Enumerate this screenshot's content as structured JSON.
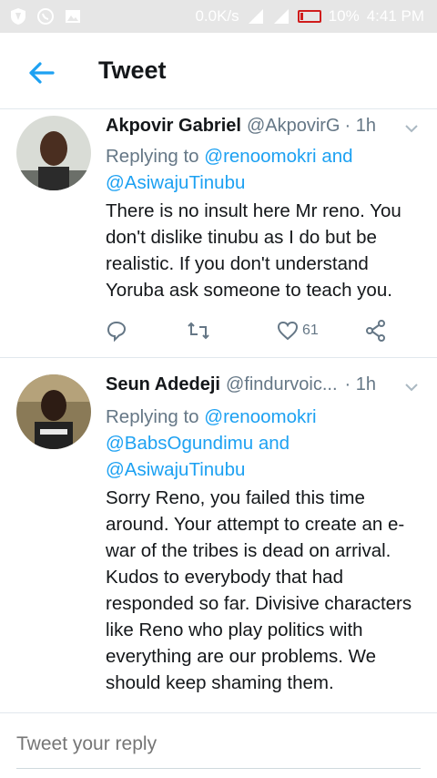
{
  "status_bar": {
    "speed": "0.0K/s",
    "battery": "10%",
    "time": "4:41 PM"
  },
  "header": {
    "title": "Tweet"
  },
  "tweets": [
    {
      "name": "Akpovir Gabriel",
      "handle": "@AkpovirG",
      "time": "· 1h",
      "replying_prefix": "Replying to ",
      "mentions_line1": "@renoomokri",
      "and1": " and",
      "mentions_line2": "@AsiwajuTinubu",
      "body": "There is no insult here Mr reno. You don't dislike tinubu as I do but be realistic. If you don't understand Yoruba ask someone to teach you.",
      "likes": "61"
    },
    {
      "name": "Seun Adedeji",
      "handle": "@findurvoic...",
      "time": "· 1h",
      "replying_prefix": "Replying to ",
      "mention_a": "@renoomokri",
      "mention_b": "@BabsOgundimu",
      "and1": " and",
      "mention_c": "@AsiwajuTinubu",
      "body": "Sorry Reno, you failed this time around. Your attempt to create an e-war of the tribes is dead on arrival. Kudos to everybody that had responded so far. Divisive characters like Reno who play politics with everything are our problems. We should keep shaming them."
    }
  ],
  "composer": {
    "placeholder": "Tweet your reply"
  },
  "colors": {
    "accent": "#1da1f2",
    "secondary_text": "#657786",
    "like_icon": "#657786"
  }
}
